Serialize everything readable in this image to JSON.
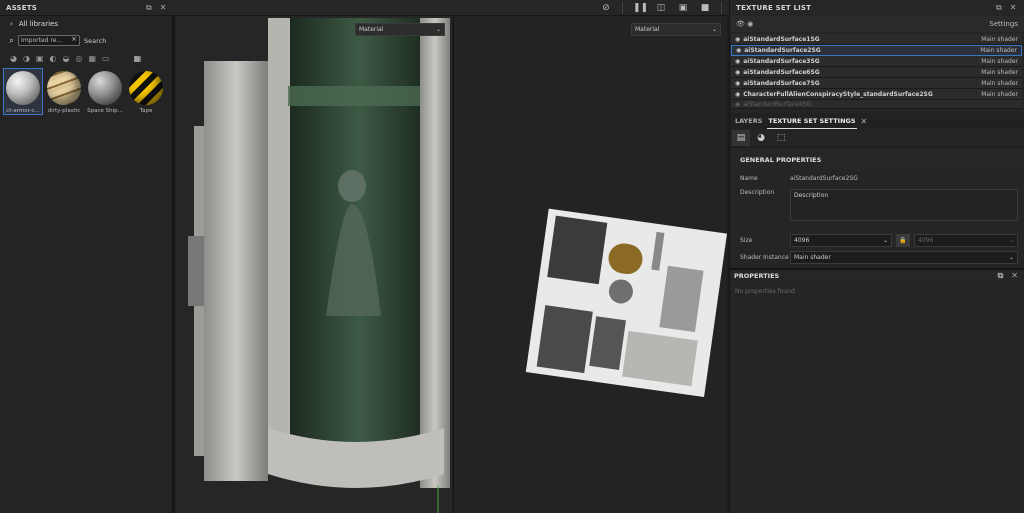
{
  "assets": {
    "title": "ASSETS",
    "library": "All libraries",
    "search_value": "Imported re...",
    "search_label": "Search",
    "items": [
      {
        "label": "ct-armor-c...",
        "selected": true
      },
      {
        "label": "dirty-plastic"
      },
      {
        "label": "Space Ship..."
      },
      {
        "label": "Tape"
      }
    ]
  },
  "viewport3d": {
    "mode": "Material"
  },
  "viewport2d": {
    "mode": "Material"
  },
  "texture_set_list": {
    "title": "TEXTURE SET LIST",
    "settings_label": "Settings",
    "rows": [
      {
        "name": "aiStandardSurface1SG",
        "shader": "Main shader"
      },
      {
        "name": "aiStandardSurface2SG",
        "shader": "Main shader",
        "selected": true
      },
      {
        "name": "aiStandardSurface3SG",
        "shader": "Main shader"
      },
      {
        "name": "aiStandardSurface6SG",
        "shader": "Main shader"
      },
      {
        "name": "aiStandardSurface7SG",
        "shader": "Main shader"
      },
      {
        "name": "CharacterFullAlienConspiracyStyle_standardSurface2SG",
        "shader": "Main shader"
      },
      {
        "name": "aiStandardSurface4SG",
        "shader": ""
      }
    ]
  },
  "tabs": {
    "layers": "LAYERS",
    "texture_set_settings": "TEXTURE SET SETTINGS"
  },
  "general": {
    "title": "GENERAL PROPERTIES",
    "name_label": "Name",
    "name_value": "aiStandardSurface2SG",
    "description_label": "Description",
    "description_value": "Description",
    "size_label": "Size",
    "size_value": "4096",
    "size_linked_value": "4096",
    "shader_label": "Shader Instance",
    "shader_value": "Main shader"
  },
  "properties": {
    "title": "PROPERTIES",
    "empty": "No properties found"
  }
}
